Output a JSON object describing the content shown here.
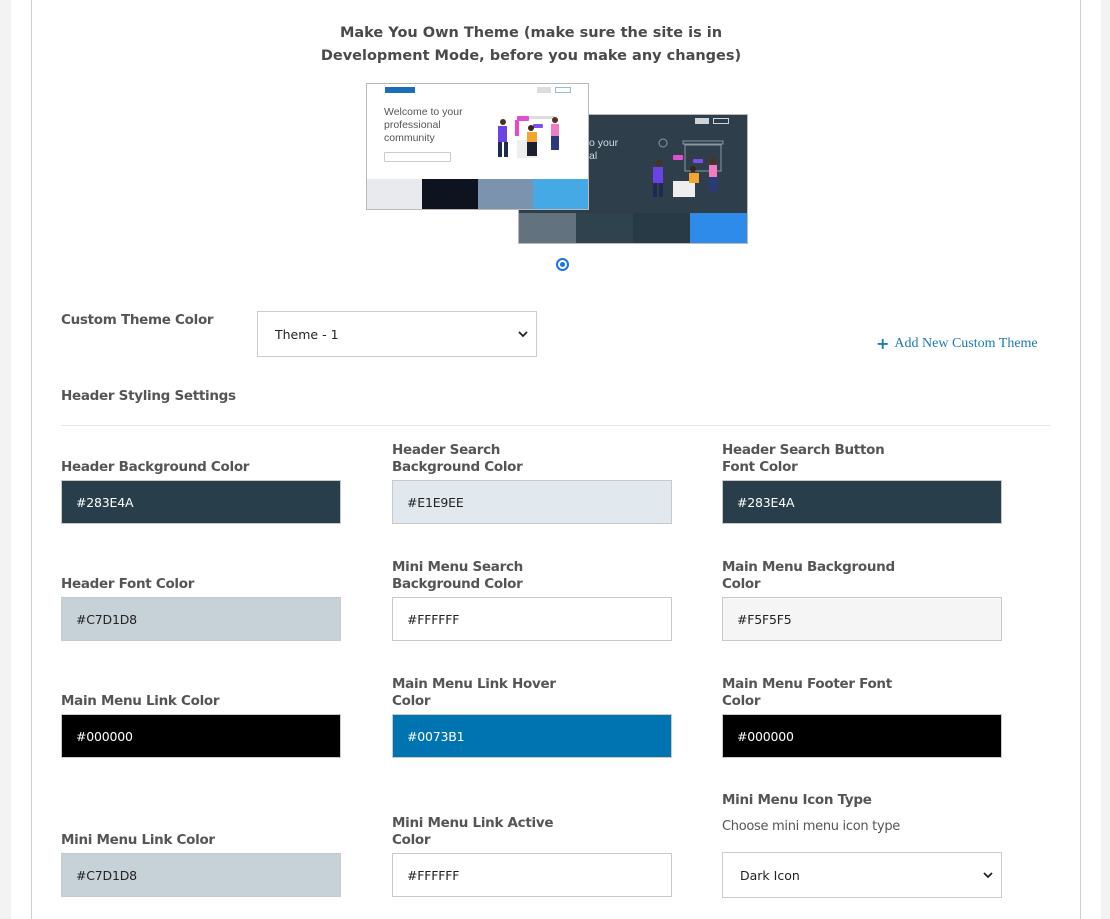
{
  "page": {
    "title_line1": "Make You Own Theme (make sure the site is in",
    "title_line2": "Development Mode, before you make any changes)"
  },
  "preview": {
    "light": {
      "heading_line1": "Welcome to your",
      "heading_line2": "professional",
      "heading_line3": "community",
      "swatches": [
        "#E8EAED",
        "#0E1320",
        "#7C93AD",
        "#45A9E6"
      ]
    },
    "dark": {
      "heading_line1": "o your",
      "heading_line2": "al",
      "swatches": [
        "#62727F",
        "#2F434F",
        "#283A46",
        "#2E8BEA"
      ]
    },
    "selected": true
  },
  "custom_theme": {
    "label": "Custom Theme Color",
    "selected": "Theme - 1",
    "add_link": "Add New Custom Theme"
  },
  "section_title": "Header Styling Settings",
  "fields": [
    {
      "label1": "",
      "label2": "Header Background Color",
      "value": "#283E4A",
      "bg": "#283E4A",
      "fg": "#ffffff"
    },
    {
      "label1": "Header Search",
      "label2": "Background Color",
      "value": "#E1E9EE",
      "bg": "#E1E9EE",
      "fg": "#222222"
    },
    {
      "label1": "Header Search Button",
      "label2": "Font Color",
      "value": "#283E4A",
      "bg": "#283E4A",
      "fg": "#ffffff"
    },
    {
      "label1": "",
      "label2": "Header Font Color",
      "value": "#C7D1D8",
      "bg": "#C7D1D8",
      "fg": "#222222"
    },
    {
      "label1": "Mini Menu Search",
      "label2": "Background Color",
      "value": "#FFFFFF",
      "bg": "#FFFFFF",
      "fg": "#222222"
    },
    {
      "label1": "Main Menu Background",
      "label2": "Color",
      "value": "#F5F5F5",
      "bg": "#F5F5F5",
      "fg": "#222222"
    },
    {
      "label1": "",
      "label2": "Main Menu Link Color",
      "value": "#000000",
      "bg": "#000000",
      "fg": "#ffffff"
    },
    {
      "label1": "Main Menu Link Hover",
      "label2": "Color",
      "value": "#0073B1",
      "bg": "#0073B1",
      "fg": "#ffffff"
    },
    {
      "label1": "Main Menu Footer Font",
      "label2": "Color",
      "value": "#000000",
      "bg": "#000000",
      "fg": "#ffffff"
    },
    {
      "label1": "",
      "label2": "Mini Menu Link Color",
      "value": "#C7D1D8",
      "bg": "#C7D1D8",
      "fg": "#222222"
    },
    {
      "label1": "Mini Menu Link Active",
      "label2": "Color",
      "value": "#FFFFFF",
      "bg": "#FFFFFF",
      "fg": "#222222"
    }
  ],
  "icon_type": {
    "label": "Mini Menu Icon Type",
    "help": "Choose mini menu icon type",
    "selected": "Dark Icon"
  },
  "colors": {
    "accent_link": "#1A7AB8",
    "radio": "#1A73E8"
  }
}
